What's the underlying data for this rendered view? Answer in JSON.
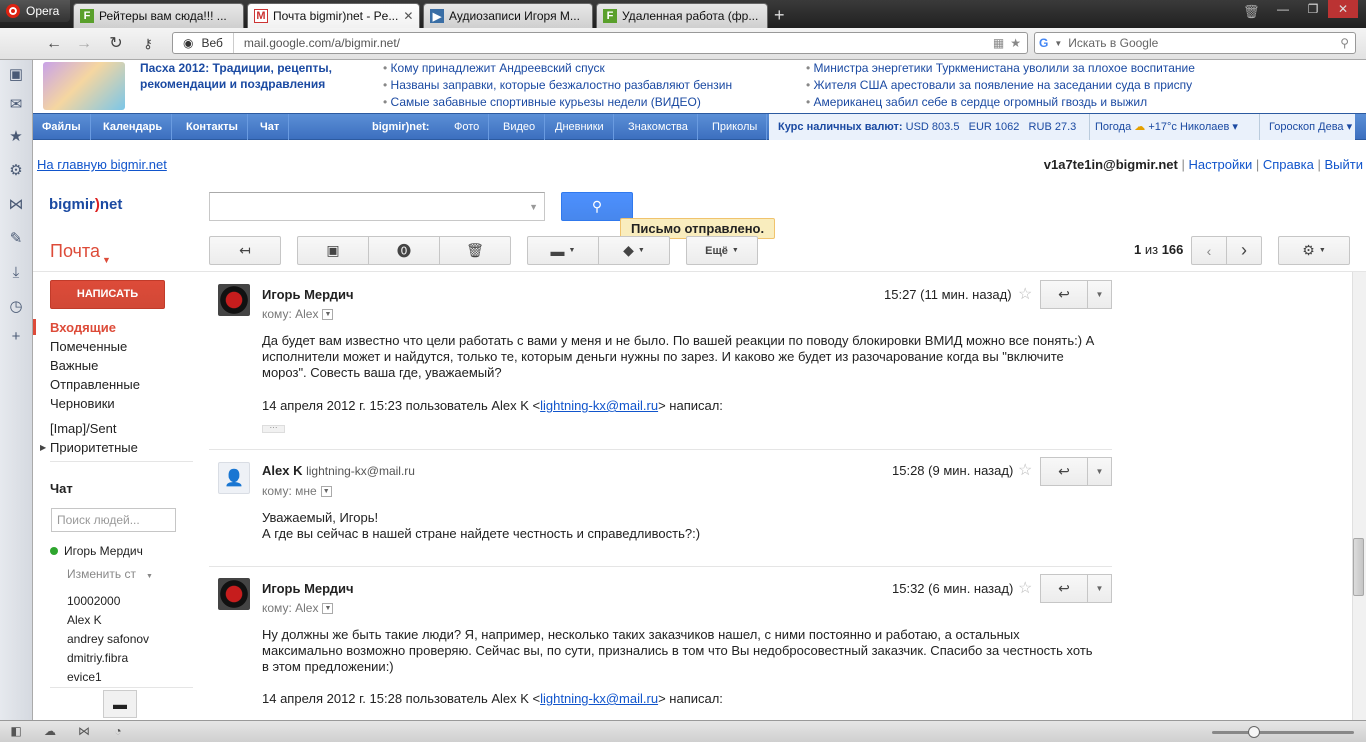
{
  "browser": {
    "menu_label": "Opera",
    "tabs": [
      {
        "title": "Рейтеры вам сюда!!! ...",
        "icon": "green-f-icon"
      },
      {
        "title": "Почта bigmir)net - Pe...",
        "icon": "gmail-icon"
      },
      {
        "title": "Аудиозаписи Игоря М...",
        "icon": "play-icon"
      },
      {
        "title": "Удаленная работа (фр...",
        "icon": "green-f-icon"
      }
    ],
    "address_label": "Веб",
    "url": "mail.google.com/a/bigmir.net/",
    "search_placeholder": "Искать в Google"
  },
  "promo": {
    "title": "Пасха 2012: Традиции, рецепты, рекомендации и поздравления",
    "news_col1": [
      "Кому принадлежит Андреевский спуск",
      "Названы заправки, которые безжалостно разбавляют бензин",
      "Самые забавные спортивные курьезы недели (ВИДЕО)"
    ],
    "news_col2": [
      "Министра энергетики Туркменистана уволили за плохое воспитание",
      "Жителя США арестовали за появление на заседании суда в приспу",
      "Американец забил себе в сердце огромный гвоздь и выжил"
    ]
  },
  "bm_nav": {
    "items": [
      "Файлы",
      "Календарь",
      "Контакты",
      "Чат"
    ],
    "brand": "bigmir)net:",
    "sections": [
      "Фото",
      "Видео",
      "Дневники",
      "Знакомства",
      "Приколы"
    ],
    "currency_label": "Курс наличных валют:",
    "currency": "USD 803.5   EUR 1062   RUB 27.3",
    "weather": "Погода",
    "weather_value": "+17°c Николаев ▾",
    "horoscope": "Гороскоп Дева ▾"
  },
  "top_links": {
    "home": "На главную bigmir.net",
    "user": "v1a7te1in@bigmir.net",
    "settings": "Настройки",
    "help": "Справка",
    "logout": "Выйти",
    "sep": "|"
  },
  "header": {
    "logo_a": "bigmir",
    "logo_b": ")",
    "logo_c": "net",
    "toast": "Письмо отправлено.",
    "mail_title": "Почта",
    "more_label": "Ещё",
    "pager_pos": "1",
    "pager_mid": " из ",
    "pager_total": "166"
  },
  "sidebar": {
    "compose": "НАПИСАТЬ",
    "folders": [
      "Входящие",
      "Помеченные",
      "Важные",
      "Отправленные",
      "Черновики"
    ],
    "labels": [
      "[Imap]/Sent",
      "Приоритетные"
    ],
    "chat_title": "Чат",
    "chat_search_placeholder": "Поиск людей...",
    "me": "Игорь Мердич",
    "status": "Изменить ст",
    "contacts": [
      "10002000",
      "Alex K",
      "andrey safonov",
      "dmitriy.fibra",
      "evice1"
    ]
  },
  "messages": [
    {
      "sender": "Игорь Мердич",
      "sender_mail": "",
      "to": "кому: Alex",
      "time": "15:27 (11 мин. назад)",
      "body": [
        "Да будет вам известно что цели работать с вами у меня и не было. По вашей реакции по поводу блокировки ВМИД можно все понять:) А",
        "исполнители может и найдутся, только те, которым деньги нужны по зарез. И каково же будет из разочарование когда вы \"включите",
        "мороз\". Совесть ваша где, уважаемый?"
      ],
      "quote_pre": "14 апреля 2012 г. 15:23 пользователь Alex K <",
      "quote_link": "lightning-kx@mail.ru",
      "quote_post": "> написал:"
    },
    {
      "sender": "Alex K",
      "sender_mail": "lightning-kx@mail.ru",
      "to": "кому: мне",
      "time": "15:28 (9 мин. назад)",
      "body": [
        "Уважаемый, Игорь!",
        "А где вы сейчас в нашей стране найдете честность и справедливость?:)"
      ]
    },
    {
      "sender": "Игорь Мердич",
      "sender_mail": "",
      "to": "кому: Alex",
      "time": "15:32 (6 мин. назад)",
      "body": [
        "Ну должны же быть такие люди? Я, например, несколько таких заказчиков нашел, с ними постоянно и работаю, а остальных",
        "максимально возможно проверяю. Сейчас вы, по сути, признались в том что Вы недобросовестный заказчик. Спасибо за честность хоть",
        "в этом предложении:)"
      ],
      "quote_pre": "14 апреля 2012 г. 15:28 пользователь Alex K <",
      "quote_link": "lightning-kx@mail.ru",
      "quote_post": "> написал:"
    }
  ],
  "colors": {
    "accent": "#dd4b39",
    "link": "#1155cc",
    "nav_blue": "#3c6fbf",
    "button_blue": "#4d90fe"
  }
}
